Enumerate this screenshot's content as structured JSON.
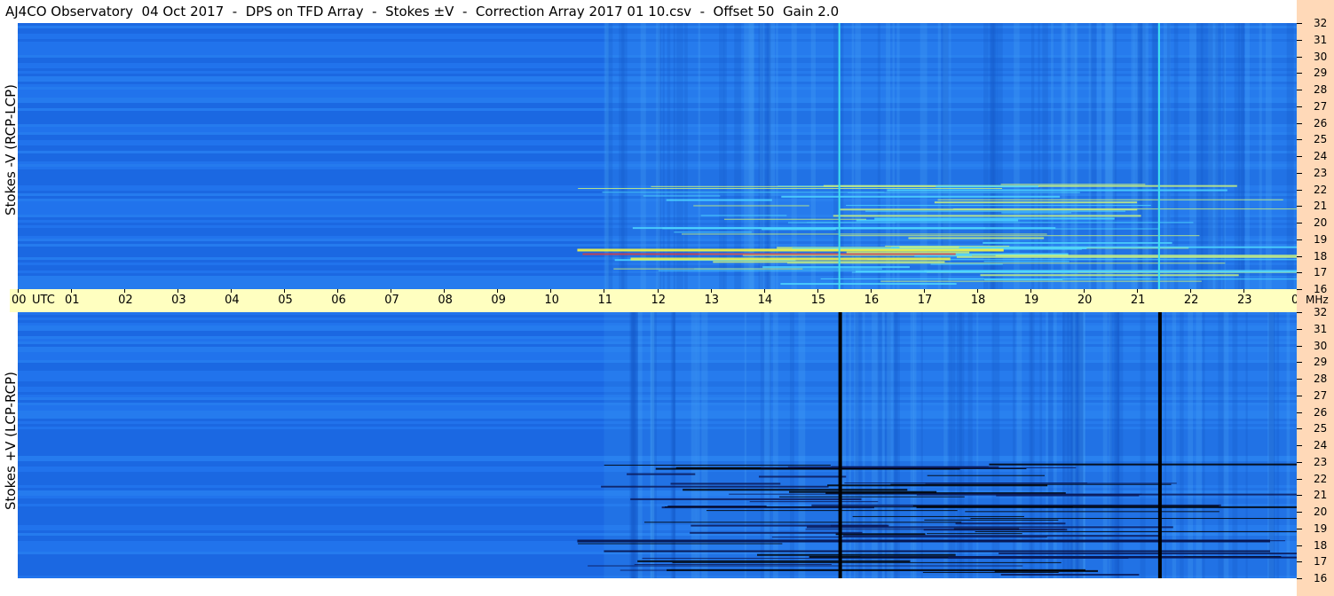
{
  "title": "AJ4CO Observatory  04 Oct 2017  -  DPS on TFD Array  -  Stokes ±V  -  Correction Array 2017 01 10.csv  -  Offset 50  Gain 2.0",
  "panels": [
    {
      "ylabel": "Stokes -V (RCP-LCP)"
    },
    {
      "ylabel": "Stokes +V (LCP-RCP)"
    }
  ],
  "time_axis": {
    "labels": [
      "00",
      "01",
      "02",
      "03",
      "04",
      "05",
      "06",
      "07",
      "08",
      "09",
      "10",
      "11",
      "12",
      "13",
      "14",
      "15",
      "16",
      "17",
      "18",
      "19",
      "20",
      "21",
      "22",
      "23",
      "00"
    ],
    "utc_label": "UTC",
    "unit": "MHz"
  },
  "freq_axis": {
    "labels": [
      "32",
      "31",
      "30",
      "29",
      "28",
      "27",
      "26",
      "25",
      "24",
      "23",
      "22",
      "21",
      "20",
      "19",
      "18",
      "17",
      "16"
    ]
  },
  "colors": {
    "background": "#1e6ee8",
    "time_axis_bg": "#ffffc0",
    "freq_axis_bg": "#ffd9b8",
    "burst": "#f5f542"
  },
  "chart_data": {
    "type": "heatmap",
    "x": {
      "label": "UTC",
      "range": [
        "00",
        "00"
      ]
    },
    "y": {
      "label": "MHz",
      "range": [
        16,
        32
      ]
    },
    "features": [
      {
        "panel": "top",
        "kind": "vertical line",
        "time_utc": 15.4,
        "color": "cyan"
      },
      {
        "panel": "top",
        "kind": "vertical line",
        "time_utc": 21.4,
        "color": "cyan"
      },
      {
        "panel": "bottom",
        "kind": "vertical line",
        "time_utc": 15.4,
        "color": "black"
      },
      {
        "panel": "bottom",
        "kind": "vertical line",
        "time_utc": 21.4,
        "color": "black"
      }
    ]
  }
}
